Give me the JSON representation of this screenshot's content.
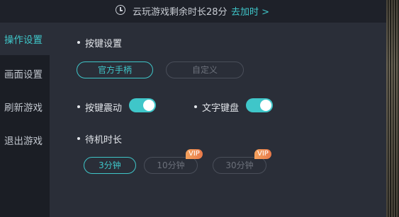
{
  "top_bar": {
    "text": "云玩游戏剩余时长28分",
    "link": "去加时 >"
  },
  "sidebar": {
    "items": [
      {
        "label": "操作设置",
        "active": true
      },
      {
        "label": "画面设置",
        "active": false
      },
      {
        "label": "刷新游戏",
        "active": false
      },
      {
        "label": "退出游戏",
        "active": false
      }
    ]
  },
  "settings": {
    "key_settings": {
      "title": "按键设置",
      "options": [
        "官方手柄",
        "自定义"
      ],
      "selected": "官方手柄"
    },
    "vibration": {
      "label": "按键震动",
      "on": true
    },
    "text_keyboard": {
      "label": "文字键盘",
      "on": true
    },
    "idle_duration": {
      "title": "待机时长",
      "options": [
        {
          "label": "3分钟",
          "vip": false
        },
        {
          "label": "10分钟",
          "vip": true,
          "badge": "VIP"
        },
        {
          "label": "30分钟",
          "vip": true,
          "badge": "VIP"
        }
      ],
      "selected": "3分钟"
    }
  },
  "colors": {
    "accent": "#3fc6c9",
    "vip_badge": "#f0955a",
    "panel_bg": "#2a2e38",
    "sidebar_bg": "#1b1e25"
  },
  "icons": {
    "time": "clock-icon"
  }
}
